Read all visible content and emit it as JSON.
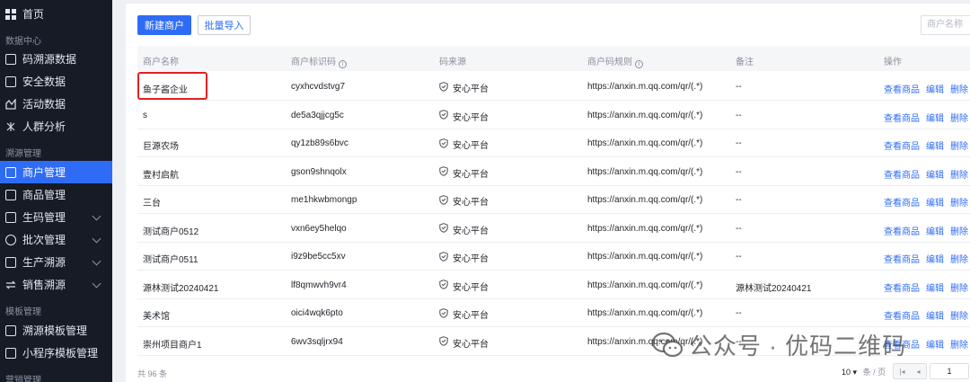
{
  "sidebar": {
    "top": {
      "label": "首页",
      "icon": "grid-icon"
    },
    "groups": [
      {
        "label": "数据中心"
      },
      {
        "label": "溯源管理"
      },
      {
        "label": "模板管理"
      },
      {
        "label": "营销管理"
      }
    ],
    "items": [
      {
        "label": "码溯源数据",
        "icon": "scan-icon"
      },
      {
        "label": "安全数据",
        "icon": "chart-icon"
      },
      {
        "label": "活动数据",
        "icon": "activity-icon"
      },
      {
        "label": "人群分析",
        "icon": "crowd-icon"
      },
      {
        "label": "商户管理",
        "icon": "store-icon",
        "active": true
      },
      {
        "label": "商品管理",
        "icon": "goods-icon"
      },
      {
        "label": "生码管理",
        "icon": "code-icon"
      },
      {
        "label": "批次管理",
        "icon": "batch-icon"
      },
      {
        "label": "生产溯源",
        "icon": "production-icon"
      },
      {
        "label": "销售溯源",
        "icon": "sales-icon"
      },
      {
        "label": "溯源模板管理",
        "icon": "template-icon"
      },
      {
        "label": "小程序模板管理",
        "icon": "miniapp-icon"
      }
    ]
  },
  "toolbar": {
    "new_merchant": "新建商户",
    "batch_import": "批量导入",
    "search_placeholder": "商户名称"
  },
  "table": {
    "headers": [
      "商户名称",
      "商户标识码",
      "码来源",
      "商户码规则",
      "备注",
      "操作"
    ],
    "rows": [
      {
        "name": "鱼子酱企业",
        "code": "cyxhcvdstvg7",
        "source": "安心平台",
        "rule": "https://anxin.m.qq.com/qr/(.*)",
        "note": "--"
      },
      {
        "name": "s",
        "code": "de5a3qjjcg5c",
        "source": "安心平台",
        "rule": "https://anxin.m.qq.com/qr/(.*)",
        "note": "--"
      },
      {
        "name": "巨源农场",
        "code": "qy1zb89s6bvc",
        "source": "安心平台",
        "rule": "https://anxin.m.qq.com/qr/(.*)",
        "note": "--"
      },
      {
        "name": "壹村启航",
        "code": "gson9shnqolx",
        "source": "安心平台",
        "rule": "https://anxin.m.qq.com/qr/(.*)",
        "note": "--"
      },
      {
        "name": "三台",
        "code": "me1hkwbmongp",
        "source": "安心平台",
        "rule": "https://anxin.m.qq.com/qr/(.*)",
        "note": "--"
      },
      {
        "name": "测试商户0512",
        "code": "vxn6ey5helqo",
        "source": "安心平台",
        "rule": "https://anxin.m.qq.com/qr/(.*)",
        "note": "--"
      },
      {
        "name": "测试商户0511",
        "code": "i9z9be5cc5xv",
        "source": "安心平台",
        "rule": "https://anxin.m.qq.com/qr/(.*)",
        "note": "--"
      },
      {
        "name": "源林测试20240421",
        "code": "lf8qmwvh9vr4",
        "source": "安心平台",
        "rule": "https://anxin.m.qq.com/qr/(.*)",
        "note": "源林测试20240421"
      },
      {
        "name": "美术馆",
        "code": "oici4wqk6pto",
        "source": "安心平台",
        "rule": "https://anxin.m.qq.com/qr/(.*)",
        "note": "--"
      },
      {
        "name": "崇州项目商户1",
        "code": "6wv3sqljrx94",
        "source": "安心平台",
        "rule": "https://anxin.m.qq.com/qr/(.*)",
        "note": "--"
      }
    ],
    "actions": [
      "查看商品",
      "编辑",
      "删除"
    ]
  },
  "footer": {
    "total": "共 96 条",
    "page_size": "10",
    "page_size_unit": "条 / 页",
    "current_page": "1"
  },
  "watermark": {
    "text": "公众号 · 优码二维码"
  },
  "colors": {
    "sidebar_bg": "#161b26",
    "accent": "#2f6cf6",
    "highlight": "#e02020"
  }
}
